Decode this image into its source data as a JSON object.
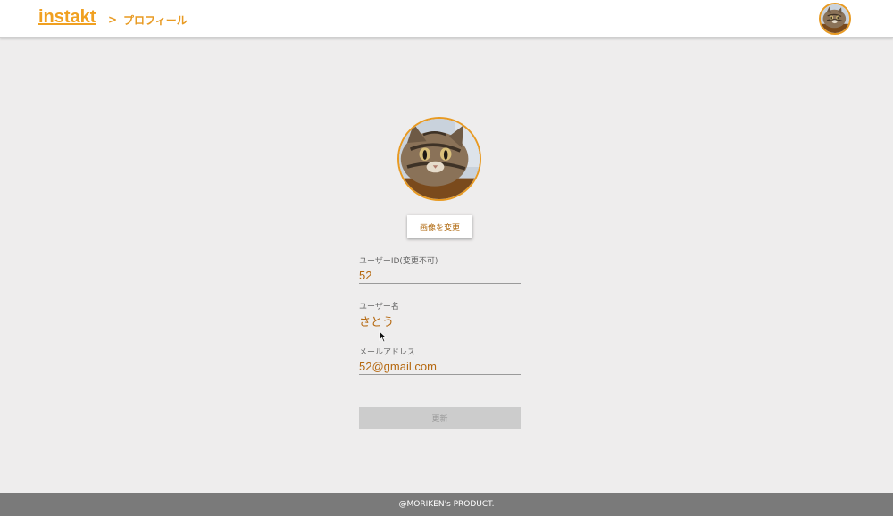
{
  "header": {
    "logo": "instakt",
    "breadcrumb_separator": ">",
    "breadcrumb_current": "プロフィール",
    "avatar_icon": "cat-avatar-icon"
  },
  "profile": {
    "avatar_icon": "cat-avatar-icon",
    "change_image_label": "画像を変更"
  },
  "form": {
    "user_id": {
      "label": "ユーザーID(変更不可)",
      "value": "52"
    },
    "username": {
      "label": "ユーザー名",
      "value": "さとう"
    },
    "email": {
      "label": "メールアドレス",
      "value": "52@gmail.com"
    },
    "submit_label": "更新"
  },
  "footer": {
    "text": "@MORIKEN's PRODUCT."
  },
  "colors": {
    "accent": "#e89a22",
    "value_text": "#b5680f",
    "background": "#eeeded",
    "footer_bg": "#7a7a7a",
    "disabled_button": "#cccccc"
  }
}
